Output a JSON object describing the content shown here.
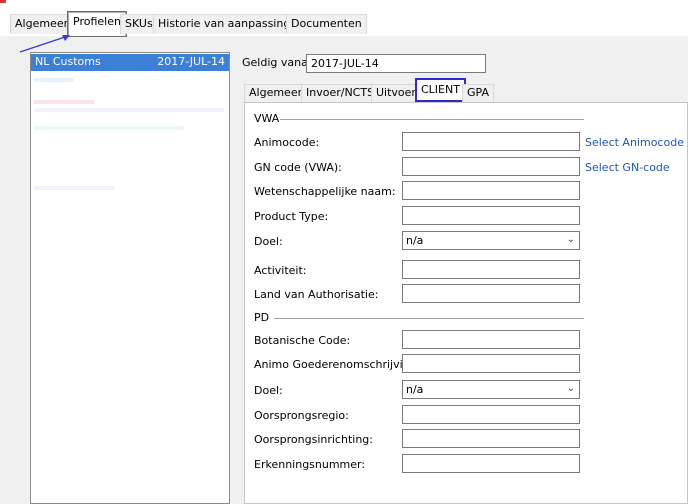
{
  "top_tabs": [
    "Algemeen",
    "Profielen",
    "SKUs",
    "Historie van aanpassingen",
    "Documenten"
  ],
  "profile_list": {
    "selected": {
      "name": "NL Customs",
      "date": "2017-JUL-14"
    }
  },
  "geldig": {
    "label": "Geldig vanaf:",
    "value": "2017-JUL-14"
  },
  "inner_tabs": [
    "Algemeen",
    "Invoer/NCTS",
    "Uitvoer",
    "CLIENT",
    "GPA"
  ],
  "vwa": {
    "section": "VWA",
    "fields": {
      "animocode": {
        "label": "Animocode:",
        "value": "",
        "link": "Select Animocode"
      },
      "gncode": {
        "label": "GN code (VWA):",
        "value": "",
        "link": "Select GN-code"
      },
      "wetnaam": {
        "label": "Wetenschappelijke naam:",
        "value": ""
      },
      "producttype": {
        "label": "Product Type:",
        "value": ""
      },
      "doel": {
        "label": "Doel:",
        "value": "n/a"
      },
      "activiteit": {
        "label": "Activiteit:",
        "value": ""
      },
      "land": {
        "label": "Land van Authorisatie:",
        "value": ""
      }
    }
  },
  "pd": {
    "section": "PD",
    "fields": {
      "botanische": {
        "label": "Botanische Code:",
        "value": ""
      },
      "animo": {
        "label": "Animo Goederenomschrijving:",
        "value": ""
      },
      "doel": {
        "label": "Doel:",
        "value": "n/a"
      },
      "regio": {
        "label": "Oorsprongsregio:",
        "value": ""
      },
      "inrichting": {
        "label": "Oorsprongsinrichting:",
        "value": ""
      },
      "erkenning": {
        "label": "Erkenningsnummer:",
        "value": ""
      }
    }
  },
  "icons": {
    "dropdown": "chevron-down-icon",
    "annotation": "arrow-annotation-icon"
  },
  "colors": {
    "selection": "#3c7fd6",
    "active_tab_border": "#2b2bd1",
    "link": "#1f56b7"
  }
}
